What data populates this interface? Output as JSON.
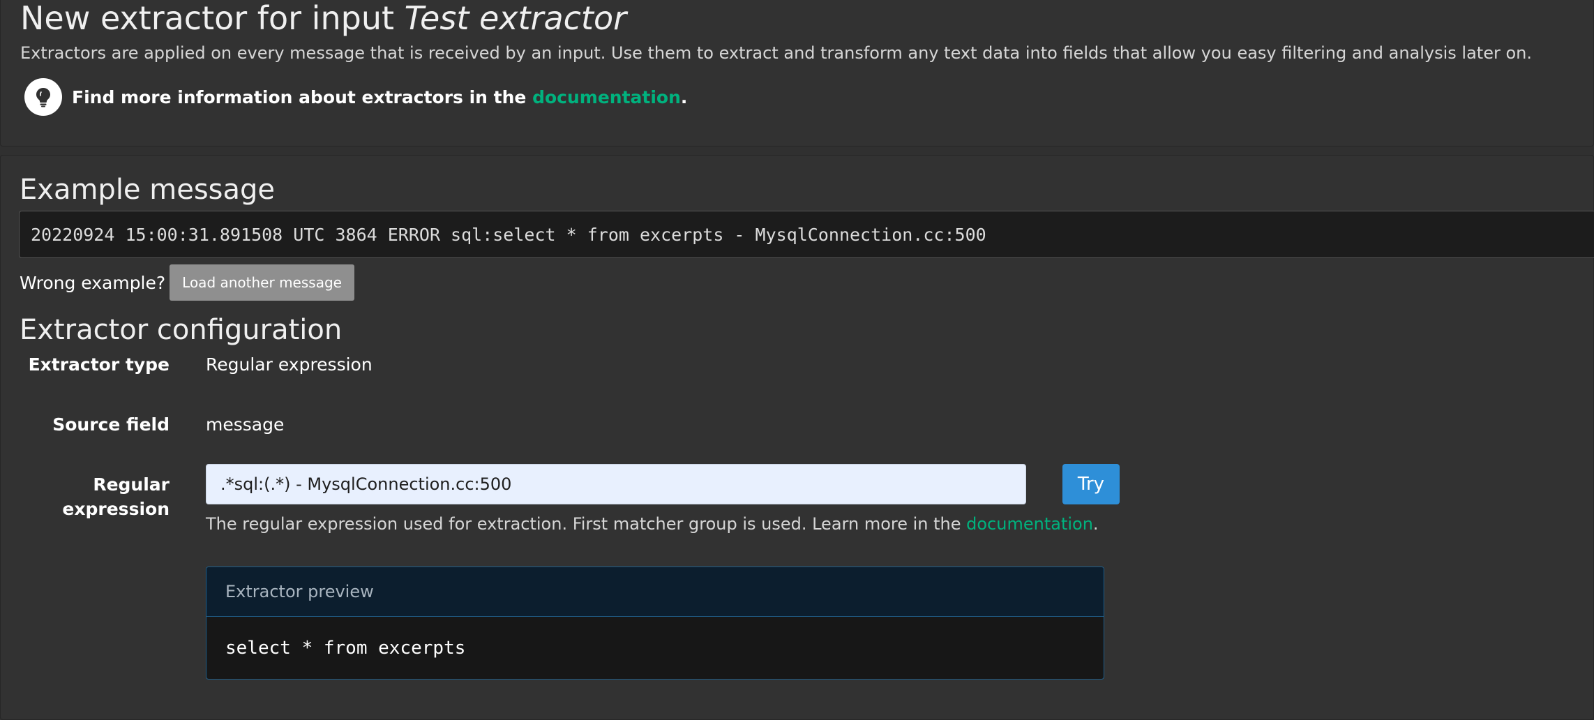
{
  "header": {
    "title_prefix": "New extractor for input ",
    "title_input_name": "Test extractor",
    "description": "Extractors are applied on every message that is received by an input. Use them to extract and transform any text data into fields that allow you easy filtering and analysis later on.",
    "info_text": "Find more information about extractors in the ",
    "info_link": "documentation",
    "info_suffix": ".",
    "info_icon": "lightbulb-icon"
  },
  "example": {
    "heading": "Example message",
    "message": "20220924 15:00:31.891508 UTC 3864 ERROR sql:select * from excerpts - MysqlConnection.cc:500",
    "wrong_example_label": "Wrong example?",
    "load_button_label": "Load another message"
  },
  "config": {
    "heading": "Extractor configuration",
    "extractor_type_label": "Extractor type",
    "extractor_type_value": "Regular expression",
    "source_field_label": "Source field",
    "source_field_value": "message",
    "regex_label": "Regular expression",
    "regex_value": ".*sql:(.*) - MysqlConnection.cc:500",
    "try_button_label": "Try",
    "help_text": "The regular expression used for extraction. First matcher group is used. Learn more in the ",
    "help_link": "documentation",
    "help_suffix": "."
  },
  "preview": {
    "heading": "Extractor preview",
    "result": "select * from excerpts"
  },
  "colors": {
    "background": "#303030",
    "link": "#00b27e",
    "primary_button": "#2e8fd8",
    "default_button": "#8f8f8f",
    "input_background": "#e8f0fe",
    "preview_heading_background": "#0c1e2e"
  }
}
